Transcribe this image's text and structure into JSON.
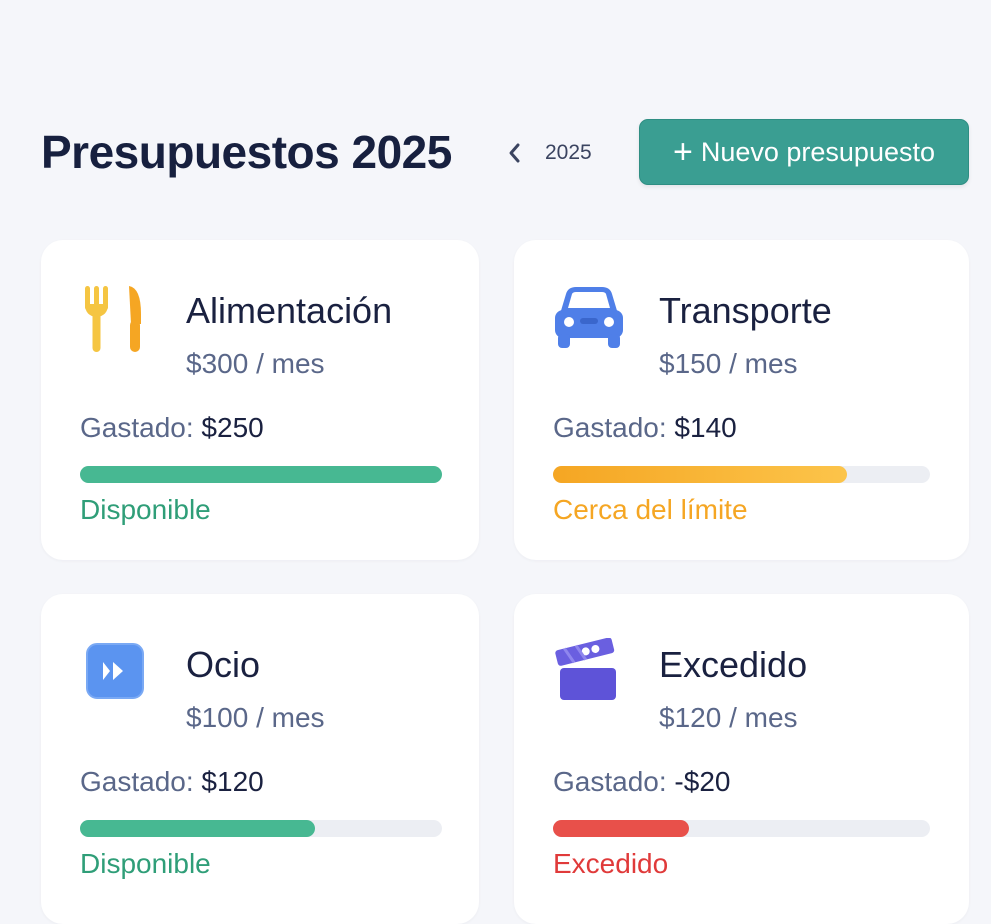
{
  "header": {
    "title": "Presupuestos 2025",
    "year": "2025",
    "new_button_label": "Nuevo presupuesto"
  },
  "colors": {
    "accent": "#3a9e92",
    "ok": "#2f9e78",
    "warning": "#f5a623",
    "danger": "#e03a3a"
  },
  "budgets": [
    {
      "name": "Alimentación",
      "icon": "fork-knife-icon",
      "amount": "$300 / mes",
      "spent_label": "Gastado:",
      "spent_value": "$250",
      "progress": 1.0,
      "status": "Disponible",
      "status_color": "#2f9e78"
    },
    {
      "name": "Transporte",
      "icon": "car-icon",
      "amount": "$150 / mes",
      "spent_label": "Gastado:",
      "spent_value": "$140",
      "progress": 0.78,
      "status": "Cerca del límite",
      "status_color": "#f5a623"
    },
    {
      "name": "Ocio",
      "icon": "play-icon",
      "amount": "$100 / mes",
      "spent_label": "Gastado:",
      "spent_value": "$120",
      "progress": 0.65,
      "status": "Disponible",
      "status_color": "#2f9e78"
    },
    {
      "name": "Excedido",
      "icon": "clapperboard-icon",
      "amount": "$120 / mes",
      "spent_label": "Gastado:",
      "spent_value": "-$20",
      "progress": 0.36,
      "status": "Excedido",
      "status_color": "#e03a3a"
    }
  ]
}
